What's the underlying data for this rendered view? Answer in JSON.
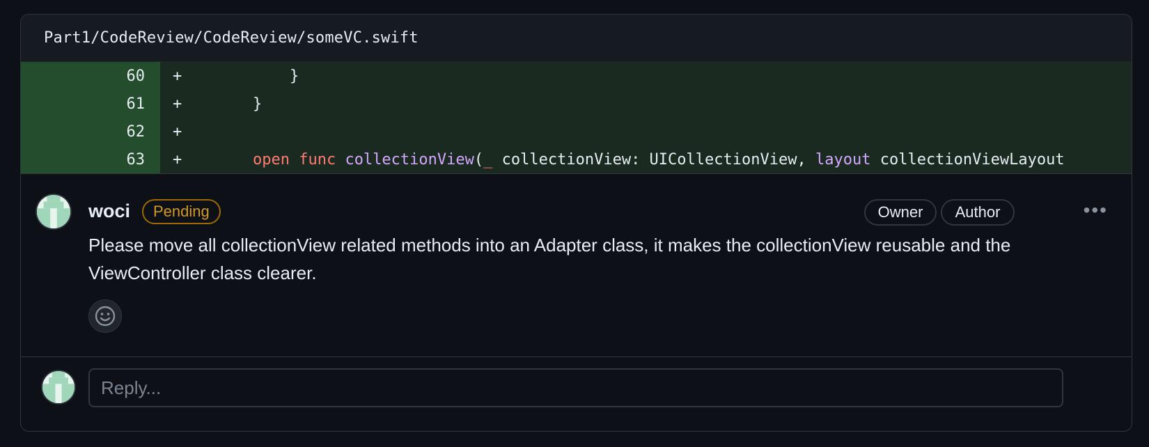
{
  "file": {
    "path": "Part1/CodeReview/CodeReview/someVC.swift"
  },
  "diff": {
    "lines": [
      {
        "num": "60",
        "marker": "+",
        "tokens": [
          {
            "text": "        }",
            "type": "plain"
          }
        ]
      },
      {
        "num": "61",
        "marker": "+",
        "tokens": [
          {
            "text": "    }",
            "type": "plain"
          }
        ]
      },
      {
        "num": "62",
        "marker": "+",
        "tokens": [
          {
            "text": "",
            "type": "plain"
          }
        ]
      },
      {
        "num": "63",
        "marker": "+",
        "tokens": [
          {
            "text": "    ",
            "type": "plain"
          },
          {
            "text": "open",
            "type": "kw"
          },
          {
            "text": " ",
            "type": "plain"
          },
          {
            "text": "func",
            "type": "kw"
          },
          {
            "text": " ",
            "type": "plain"
          },
          {
            "text": "collectionView",
            "type": "fn"
          },
          {
            "text": "(",
            "type": "plain"
          },
          {
            "text": "_",
            "type": "kw"
          },
          {
            "text": " collectionView: UICollectionView, ",
            "type": "plain"
          },
          {
            "text": "layout",
            "type": "fn"
          },
          {
            "text": " collectionViewLayout",
            "type": "plain"
          }
        ]
      }
    ]
  },
  "comment": {
    "author": "woci",
    "status_badge": "Pending",
    "roles": [
      "Owner",
      "Author"
    ],
    "more_icon": "kebab-horizontal-icon",
    "body": "Please move all collectionView related methods into an Adapter class, it makes the collectionView reusable and the ViewController class clearer.",
    "reaction_icon": "smiley-icon"
  },
  "reply": {
    "placeholder": "Reply..."
  },
  "colors": {
    "added_line_bg": "#1a2a20",
    "added_gutter_bg": "#234d2c",
    "keyword": "#ff7b72",
    "function": "#d2a8ff",
    "pending": "#d29922",
    "avatar_green": "#a0d6b9"
  }
}
